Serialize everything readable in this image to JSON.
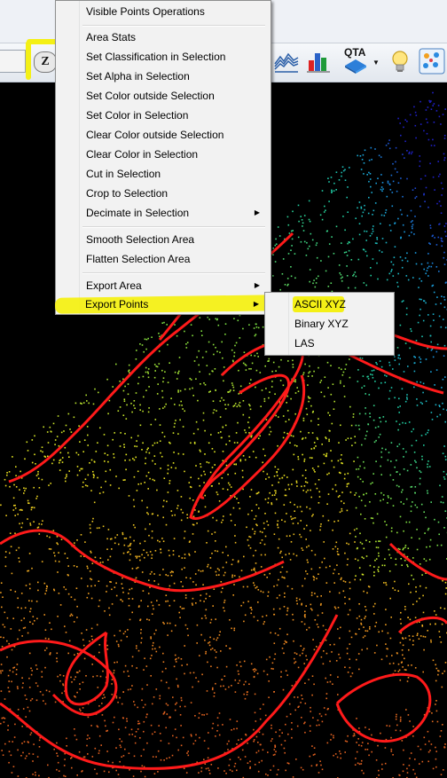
{
  "toolbar": {
    "z_button_label": "Z",
    "qta_label": "QTA",
    "highlight_color": "#f4f016",
    "icons": [
      "terrain-icon",
      "bar-chart-3d-icon",
      "qta-icon",
      "dropdown-arrow-icon",
      "lightbulb-icon",
      "points-palette-icon"
    ]
  },
  "menu": {
    "header": "Visible Points Operations",
    "groups": [
      [
        "Area Stats",
        "Set Classification in Selection",
        "Set Alpha in Selection",
        "Set Color outside Selection",
        "Set Color in Selection",
        "Clear Color outside Selection",
        "Clear Color in Selection",
        "Cut in Selection",
        "Crop to Selection",
        "Decimate in Selection"
      ],
      [
        "Smooth Selection Area",
        "Flatten Selection Area"
      ],
      [
        "Export Area",
        "Export Points"
      ]
    ],
    "submenu_arrow": "▶"
  },
  "submenu": {
    "items": [
      "ASCII XYZ",
      "Binary XYZ",
      "LAS"
    ]
  },
  "map": {
    "background": "#000000",
    "contour_color": "#ff1a1a",
    "gradient": [
      "#2020c8",
      "#1aa0e0",
      "#20d0a0",
      "#80e040",
      "#e8e820",
      "#f0a020",
      "#e06020"
    ]
  }
}
